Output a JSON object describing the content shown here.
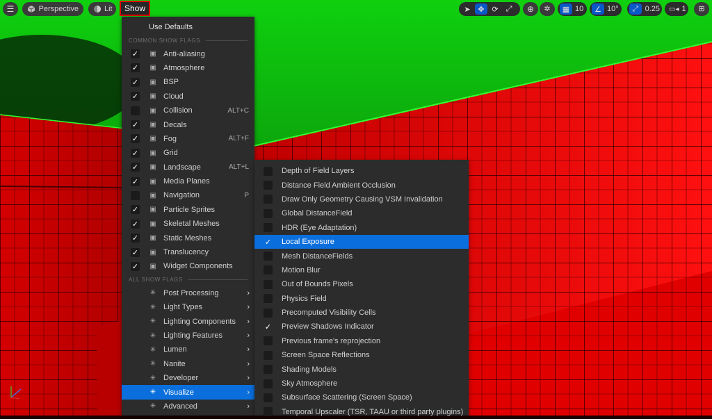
{
  "toolbar": {
    "perspective_label": "Perspective",
    "lit_label": "Lit",
    "show_label": "Show",
    "grid_value": "10",
    "angle_value": "10°",
    "scale_value": "0.25",
    "camera_value": "1"
  },
  "show_menu": {
    "use_defaults": "Use Defaults",
    "common_header": "COMMON SHOW FLAGS",
    "all_header": "ALL SHOW FLAGS",
    "common_items": [
      {
        "label": "Anti-aliasing",
        "checked": true,
        "shortcut": "",
        "icon": "anti-aliasing-icon"
      },
      {
        "label": "Atmosphere",
        "checked": true,
        "shortcut": "",
        "icon": "atmosphere-icon"
      },
      {
        "label": "BSP",
        "checked": true,
        "shortcut": "",
        "icon": "bsp-icon"
      },
      {
        "label": "Cloud",
        "checked": true,
        "shortcut": "",
        "icon": "cloud-icon"
      },
      {
        "label": "Collision",
        "checked": false,
        "shortcut": "ALT+C",
        "icon": "collision-icon"
      },
      {
        "label": "Decals",
        "checked": true,
        "shortcut": "",
        "icon": "decals-icon"
      },
      {
        "label": "Fog",
        "checked": true,
        "shortcut": "ALT+F",
        "icon": "fog-icon"
      },
      {
        "label": "Grid",
        "checked": true,
        "shortcut": "",
        "icon": "grid-icon"
      },
      {
        "label": "Landscape",
        "checked": true,
        "shortcut": "ALT+L",
        "icon": "landscape-icon"
      },
      {
        "label": "Media Planes",
        "checked": true,
        "shortcut": "",
        "icon": "media-planes-icon"
      },
      {
        "label": "Navigation",
        "checked": false,
        "shortcut": "P",
        "icon": "navigation-icon"
      },
      {
        "label": "Particle Sprites",
        "checked": true,
        "shortcut": "",
        "icon": "particle-sprites-icon"
      },
      {
        "label": "Skeletal Meshes",
        "checked": true,
        "shortcut": "",
        "icon": "skeletal-meshes-icon"
      },
      {
        "label": "Static Meshes",
        "checked": true,
        "shortcut": "",
        "icon": "static-meshes-icon"
      },
      {
        "label": "Translucency",
        "checked": true,
        "shortcut": "",
        "icon": "translucency-icon"
      },
      {
        "label": "Widget Components",
        "checked": true,
        "shortcut": "",
        "icon": "widget-components-icon"
      }
    ],
    "submenus": [
      {
        "label": "Post Processing",
        "icon": "post-processing-icon",
        "highlighted": false
      },
      {
        "label": "Light Types",
        "icon": "light-types-icon",
        "highlighted": false
      },
      {
        "label": "Lighting Components",
        "icon": "lighting-components-icon",
        "highlighted": false
      },
      {
        "label": "Lighting Features",
        "icon": "lighting-features-icon",
        "highlighted": false
      },
      {
        "label": "Lumen",
        "icon": "lumen-icon",
        "highlighted": false
      },
      {
        "label": "Nanite",
        "icon": "nanite-icon",
        "highlighted": false
      },
      {
        "label": "Developer",
        "icon": "developer-icon",
        "highlighted": false
      },
      {
        "label": "Visualize",
        "icon": "visualize-icon",
        "highlighted": true
      },
      {
        "label": "Advanced",
        "icon": "advanced-icon",
        "highlighted": false
      }
    ]
  },
  "visualize_menu": {
    "items": [
      {
        "label": "Depth of Field Layers",
        "checked": false,
        "highlighted": false,
        "box": true
      },
      {
        "label": "Distance Field Ambient Occlusion",
        "checked": false,
        "highlighted": false,
        "box": true
      },
      {
        "label": "Draw Only Geometry Causing VSM Invalidation",
        "checked": false,
        "highlighted": false,
        "box": true
      },
      {
        "label": "Global DistanceField",
        "checked": false,
        "highlighted": false,
        "box": true
      },
      {
        "label": "HDR (Eye Adaptation)",
        "checked": false,
        "highlighted": false,
        "box": true
      },
      {
        "label": "Local Exposure",
        "checked": true,
        "highlighted": true,
        "box": false
      },
      {
        "label": "Mesh DistanceFields",
        "checked": false,
        "highlighted": false,
        "box": true
      },
      {
        "label": "Motion Blur",
        "checked": false,
        "highlighted": false,
        "box": true
      },
      {
        "label": "Out of Bounds Pixels",
        "checked": false,
        "highlighted": false,
        "box": true
      },
      {
        "label": "Physics Field",
        "checked": false,
        "highlighted": false,
        "box": true
      },
      {
        "label": "Precomputed Visibility Cells",
        "checked": false,
        "highlighted": false,
        "box": true
      },
      {
        "label": "Preview Shadows Indicator",
        "checked": true,
        "highlighted": false,
        "box": false
      },
      {
        "label": "Previous frame's reprojection",
        "checked": false,
        "highlighted": false,
        "box": true
      },
      {
        "label": "Screen Space Reflections",
        "checked": false,
        "highlighted": false,
        "box": true
      },
      {
        "label": "Shading Models",
        "checked": false,
        "highlighted": false,
        "box": true
      },
      {
        "label": "Sky Atmosphere",
        "checked": false,
        "highlighted": false,
        "box": true
      },
      {
        "label": "Subsurface Scattering (Screen Space)",
        "checked": false,
        "highlighted": false,
        "box": true
      },
      {
        "label": "Temporal Upscaler (TSR, TAAU or third party plugins)",
        "checked": false,
        "highlighted": false,
        "box": true
      }
    ]
  },
  "colors": {
    "highlight": "#0a6fdc",
    "menu_bg": "#2c2c2c",
    "show_outline": "#e00000"
  }
}
